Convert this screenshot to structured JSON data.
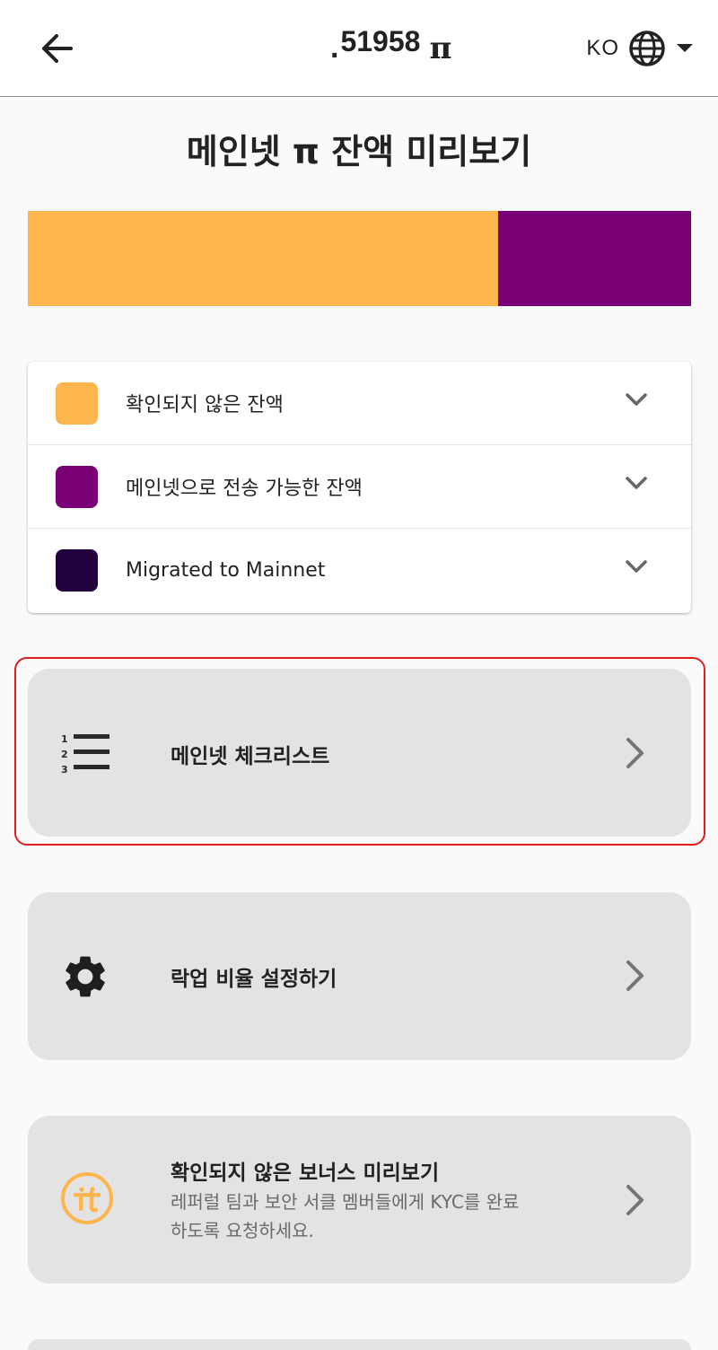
{
  "header": {
    "balance_dot": ".",
    "balance_value": "51958",
    "currency_symbol": "π",
    "language_code": "KO",
    "icons": {
      "back": "arrow-left-icon",
      "language": "globe-icon",
      "dropdown": "caret-down-icon"
    }
  },
  "page_title": "메인넷 π 잔액 미리보기",
  "balance_bar": {
    "segments": [
      {
        "name": "unverified",
        "fraction": 0.709,
        "color": "#FDB54E"
      },
      {
        "name": "transferable",
        "fraction": 0.291,
        "color": "#7A0076"
      }
    ]
  },
  "legend": {
    "items": [
      {
        "label": "확인되지 않은 잔액",
        "color": "#FDB54E"
      },
      {
        "label": "메인넷으로 전송 가능한 잔액",
        "color": "#7A0076"
      },
      {
        "label": "Migrated to Mainnet",
        "color": "#22003E"
      }
    ]
  },
  "menu": {
    "checklist": {
      "title": "메인넷 체크리스트",
      "icon": "numbered-list-icon"
    },
    "lockup": {
      "title": "락업 비율 설정하기",
      "icon": "gear-icon"
    },
    "bonus": {
      "title": "확인되지 않은 보너스 미리보기",
      "subtitle_line1": "레퍼럴 팀과 보안 서클 멤버들에게 KYC를 완료",
      "subtitle_line2": "하도록 요청하세요.",
      "icon": "pi-coin-icon",
      "icon_color": "#FDB54E"
    }
  },
  "colors": {
    "highlight": "#E11D1D",
    "card_bg": "#E3E3E3",
    "chevron": "#757575"
  }
}
